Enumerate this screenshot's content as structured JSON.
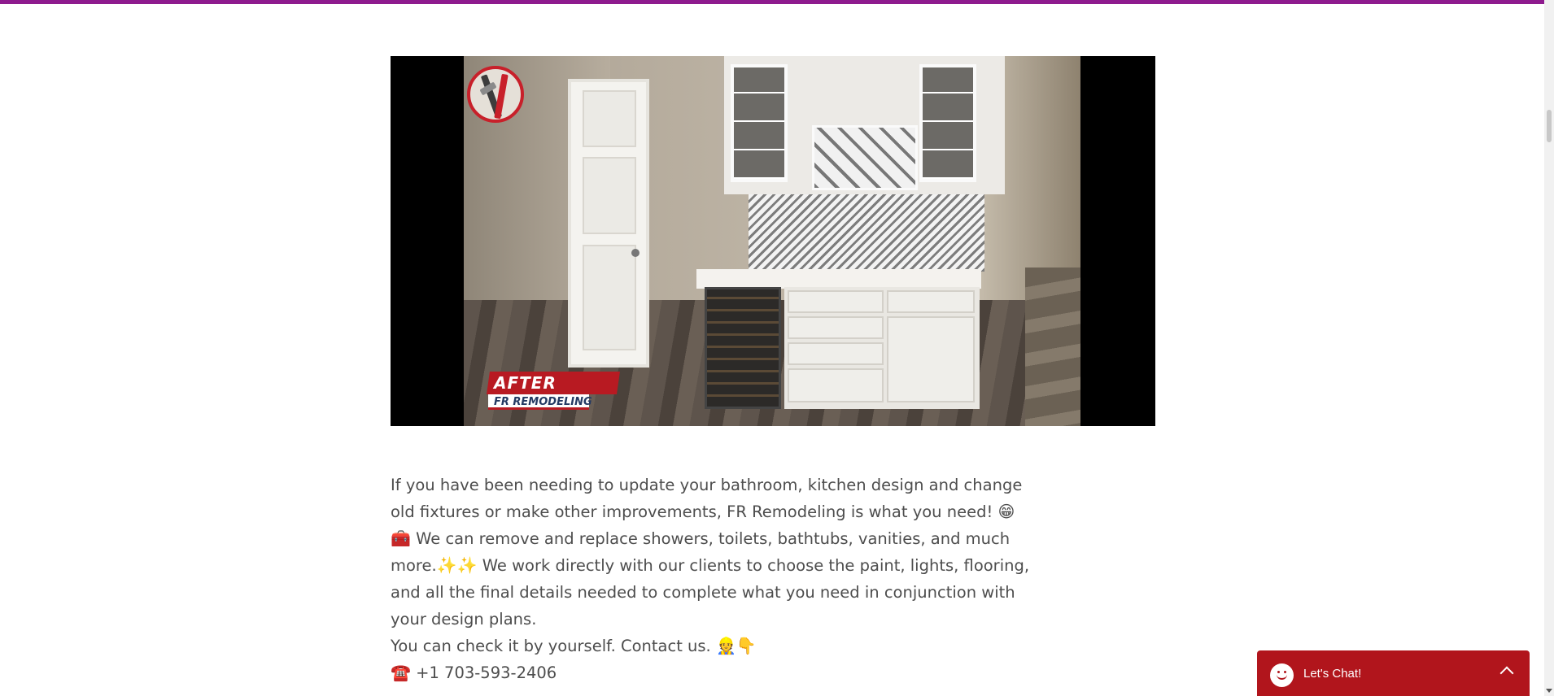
{
  "video": {
    "after_label": "AFTER",
    "brand_label": "FR REMODELING",
    "logo_icon": "tools-icon"
  },
  "content": {
    "paragraph1_a": "If you have been needing to update your bathroom, kitchen design and change old fixtures or make other improvements, FR Remodeling is what you need!",
    "emoji_grin": "😁",
    "emoji_toolbox": "🧰",
    "paragraph1_b": "We can remove and replace showers, toilets, bathtubs, vanities, and much more.",
    "emoji_sparkles": "✨✨",
    "paragraph1_c": "We work directly with our clients to choose the paint, lights, flooring, and all the final details needed to complete what you need in conjunction with your design plans.",
    "paragraph2": "You can check it by yourself. Contact us.",
    "emoji_contact": "👷👇",
    "emoji_phone": "☎️",
    "phone_number": "+1 703-593-2406"
  },
  "chat": {
    "label": "Let's Chat!",
    "accent": "#b1151c"
  },
  "colors": {
    "top_bar": "#8e1b8e",
    "brand_red": "#b81a22",
    "text": "#4d4d4d"
  }
}
